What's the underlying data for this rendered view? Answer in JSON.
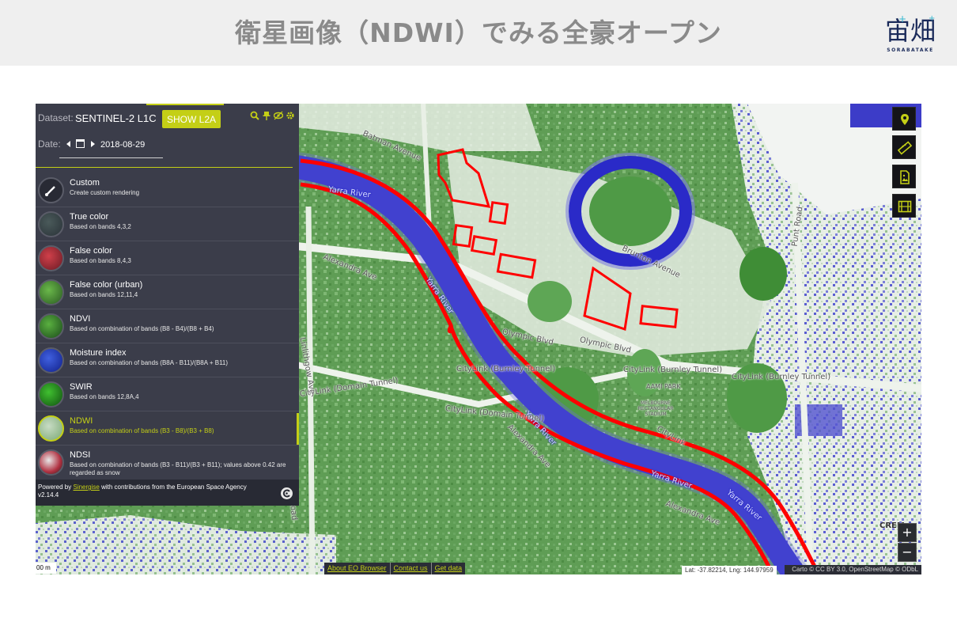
{
  "slide": {
    "title": "衛星画像（NDWI）でみる全豪オープン",
    "logo_text": "SORABATAKE",
    "logo_kanji": "宙畑"
  },
  "colors": {
    "accent": "#c4cf16",
    "panel_bg": "#3b3d4a",
    "water": "#2a2ac8",
    "vegetation": "#5f9d55",
    "annotation": "#ff0000"
  },
  "panel": {
    "dataset_label": "Dataset:",
    "dataset_value": "SENTINEL-2 L1C",
    "show_l2a_label": "SHOW L2A",
    "date_label": "Date:",
    "date_value": "2018-08-29",
    "icons": [
      "search-icon",
      "pin-icon",
      "eye-icon",
      "gear-icon"
    ],
    "layers": [
      {
        "name": "Custom",
        "desc": "Create custom rendering"
      },
      {
        "name": "True color",
        "desc": "Based on bands 4,3,2"
      },
      {
        "name": "False color",
        "desc": "Based on bands 8,4,3"
      },
      {
        "name": "False color (urban)",
        "desc": "Based on bands 12,11,4"
      },
      {
        "name": "NDVI",
        "desc": "Based on combination of bands (B8 - B4)/(B8 + B4)"
      },
      {
        "name": "Moisture index",
        "desc": "Based on combination of bands (B8A - B11)/(B8A + B11)"
      },
      {
        "name": "SWIR",
        "desc": "Based on bands 12,8A,4"
      },
      {
        "name": "NDWI",
        "desc": "Based on combination of bands (B3 - B8)/(B3 + B8)"
      },
      {
        "name": "NDSI",
        "desc": "Based on combination of bands (B3 - B11)/(B3 + B11); values above 0.42 are regarded as snow"
      }
    ],
    "active_layer": "NDWI",
    "footer": {
      "powered_prefix": "Powered by",
      "powered_link": "Sinergise",
      "powered_suffix": "with contributions from the European Space Agency",
      "version": "v2.14.4"
    }
  },
  "map": {
    "labels": {
      "yarra_river": "Yarra River",
      "alexandra_ave": "Alexandra Ave",
      "brunton_avenue": "Brunton Avenue",
      "olympic_blvd": "Olympic Blvd",
      "citylink_burnley": "CityLink (Burnley Tunnel)",
      "citylink_domain": "CityLink (Domain Tunnel)",
      "aami_park": "AAMI PARK",
      "melbourne_rugby": "MELBOURNE RECTANGULAR STADIUM",
      "linlithgow_ave": "Linlithgow Ave",
      "st_kilda_road": "St Kilda Road",
      "punt_road": "Punt Road",
      "batman_ave": "Batman Avenue",
      "citylink_short": "CityLink",
      "crem": "CREM"
    },
    "tools": [
      "location-pin-icon",
      "ruler-icon",
      "image-export-icon",
      "film-icon"
    ],
    "zoom_in": "+",
    "zoom_out": "−",
    "scale": "00 m",
    "bottom_links": [
      "About EO Browser",
      "Contact us",
      "Get data"
    ],
    "coords": "Lat: -37.82214, Lng: 144.97959",
    "attribution": "Carto © CC BY 3.0, OpenStreetMap © ODbL"
  }
}
